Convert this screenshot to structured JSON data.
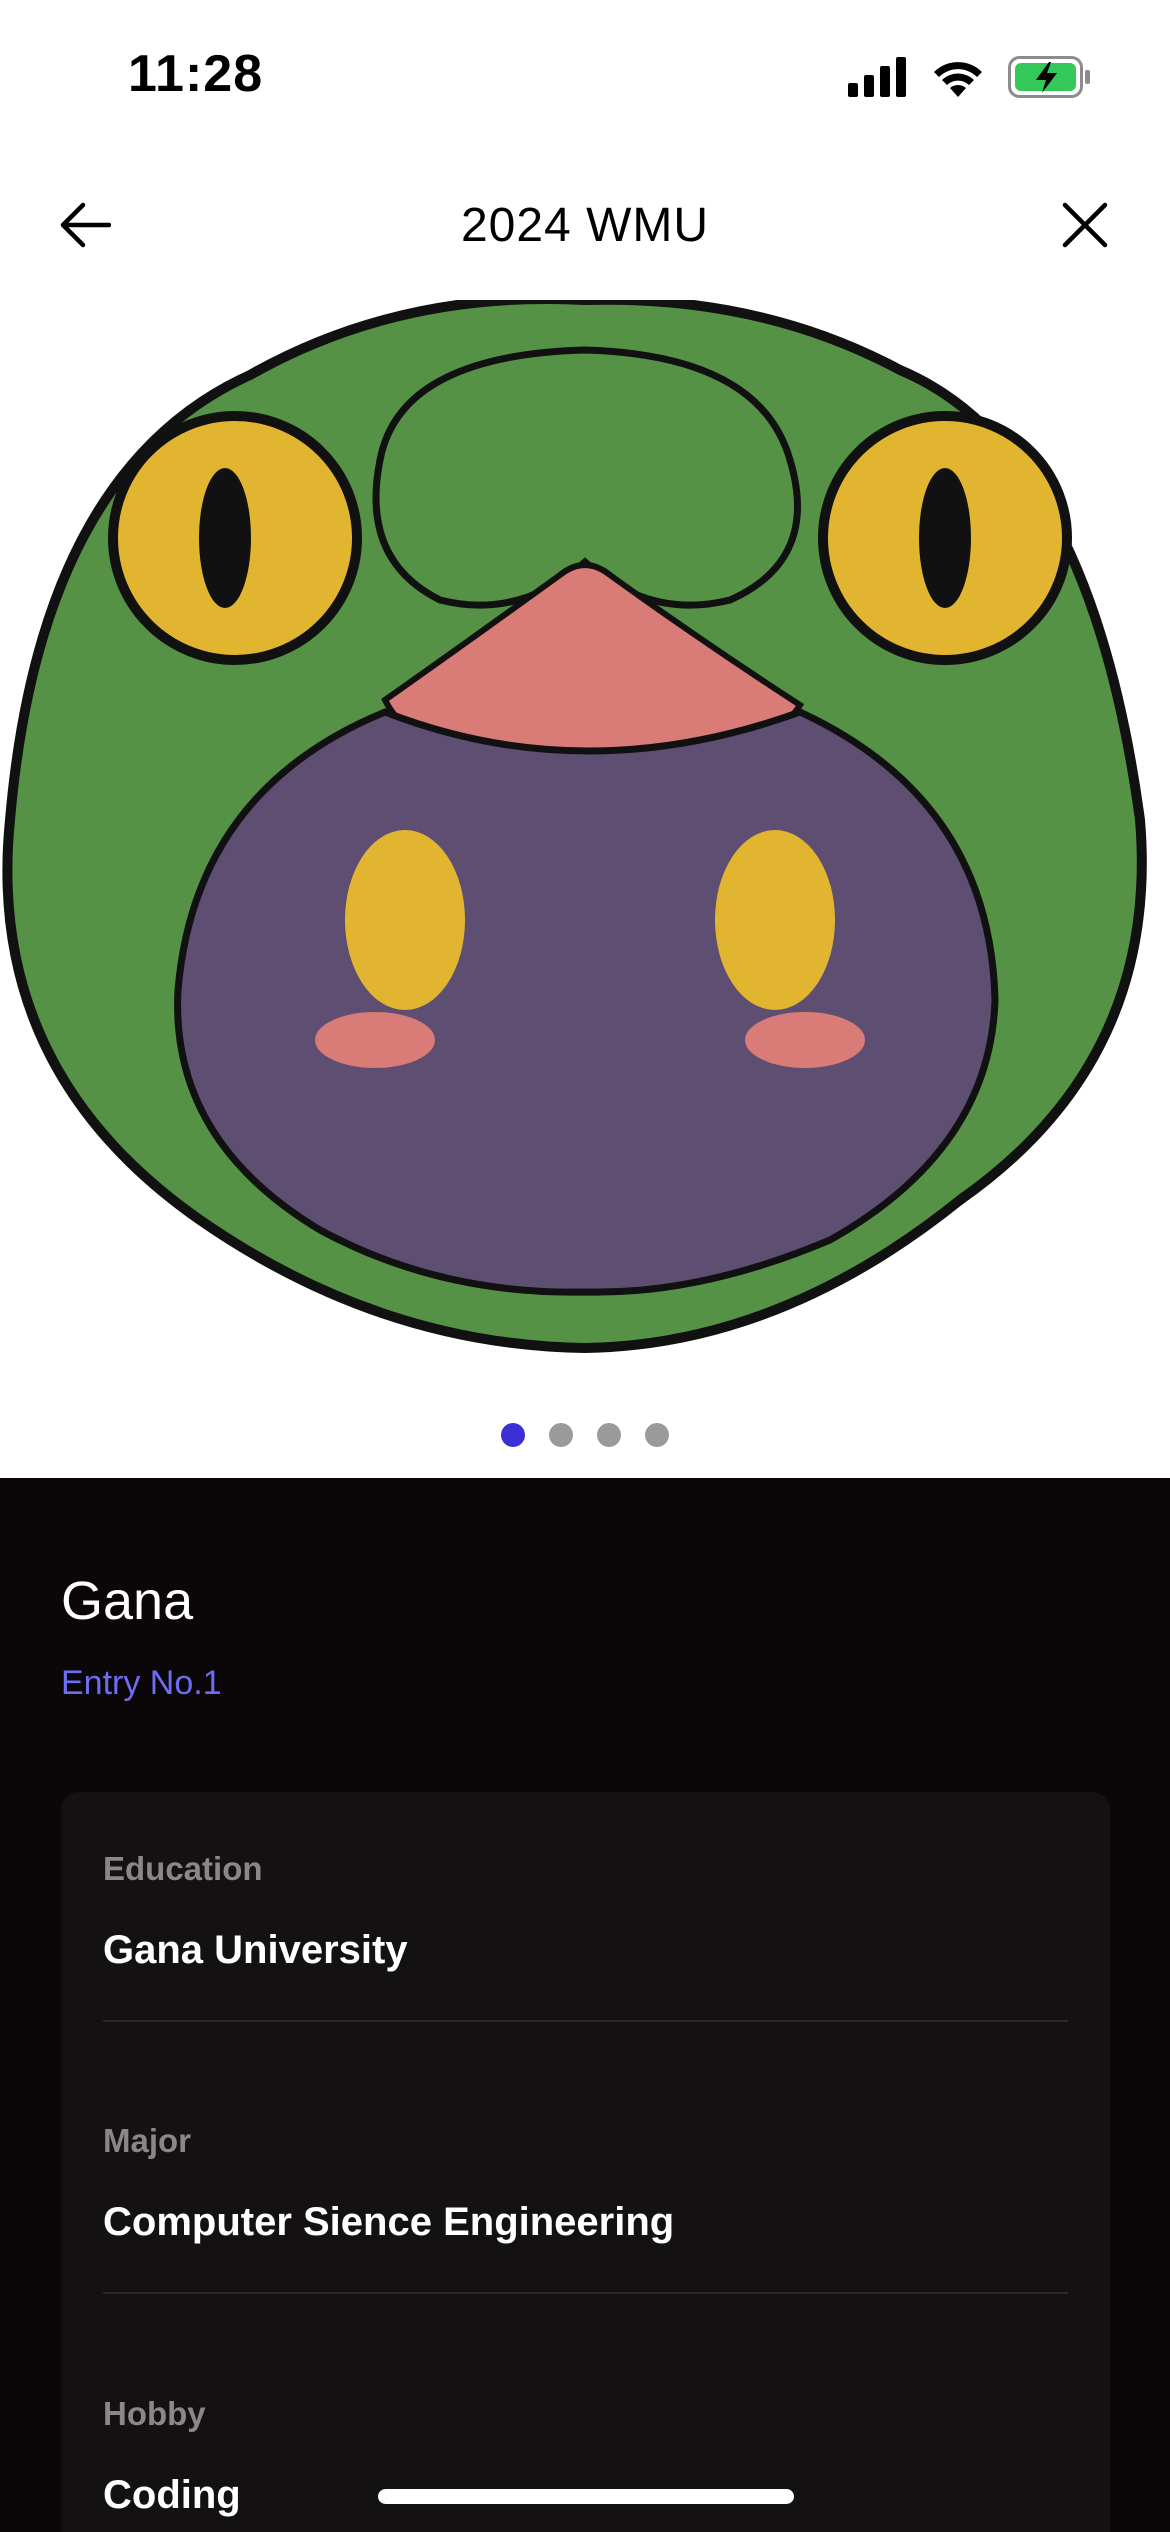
{
  "status_bar": {
    "time": "11:28",
    "icons": [
      "cellular-signal-icon",
      "wifi-icon",
      "battery-charging-icon"
    ],
    "battery_color": "#34c759"
  },
  "nav": {
    "title": "2024 WMU",
    "back_icon": "arrow-left-icon",
    "close_icon": "close-icon"
  },
  "hero": {
    "image": "frog-hood-character-illustration",
    "pager_count": 4,
    "pager_active_index": 0,
    "pager_active_color": "#3b2fd6"
  },
  "profile": {
    "name": "Gana",
    "entry": "Entry No.1",
    "accent_color": "#6e6cf2"
  },
  "info": {
    "education_label": "Education",
    "education_value": "Gana University",
    "major_label": "Major",
    "major_value": "Computer Sience Engineering",
    "hobby_label": "Hobby",
    "hobby_value": "Coding"
  }
}
